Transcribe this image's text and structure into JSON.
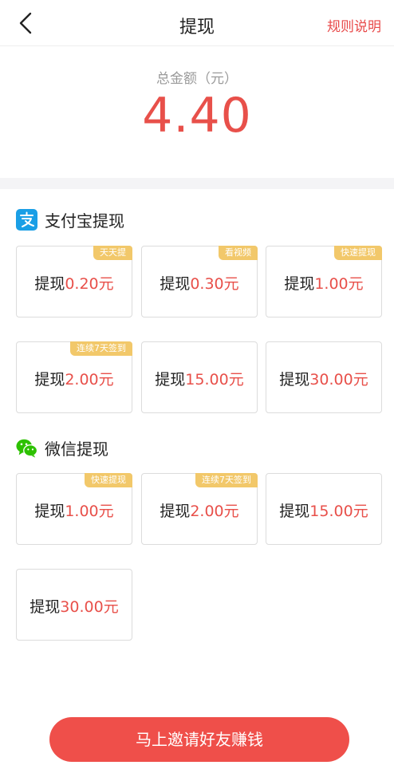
{
  "header": {
    "title": "提现",
    "rules_label": "规则说明",
    "back_icon": "chevron-left-icon"
  },
  "balance": {
    "label": "总金额（元）",
    "amount": "4.40"
  },
  "alipay": {
    "title": "支付宝提现",
    "icon": "alipay-icon",
    "cards": [
      {
        "prefix": "提现",
        "amount": "0.20元",
        "tag": "天天提"
      },
      {
        "prefix": "提现",
        "amount": "0.30元",
        "tag": "看视频"
      },
      {
        "prefix": "提现",
        "amount": "1.00元",
        "tag": "快速提现"
      },
      {
        "prefix": "提现",
        "amount": "2.00元",
        "tag": "连续7天签到"
      },
      {
        "prefix": "提现",
        "amount": "15.00元",
        "tag": ""
      },
      {
        "prefix": "提现",
        "amount": "30.00元",
        "tag": ""
      }
    ]
  },
  "wechat": {
    "title": "微信提现",
    "icon": "wechat-icon",
    "cards": [
      {
        "prefix": "提现",
        "amount": "1.00元",
        "tag": "快速提现"
      },
      {
        "prefix": "提现",
        "amount": "2.00元",
        "tag": "连续7天签到"
      },
      {
        "prefix": "提现",
        "amount": "15.00元",
        "tag": ""
      },
      {
        "prefix": "提现",
        "amount": "30.00元",
        "tag": ""
      }
    ]
  },
  "invite_button": "马上邀请好友赚钱",
  "colors": {
    "accent": "#e8504a",
    "tag": "#f2c86a",
    "alipay": "#1a9fe6",
    "wechat": "#2dc100"
  }
}
